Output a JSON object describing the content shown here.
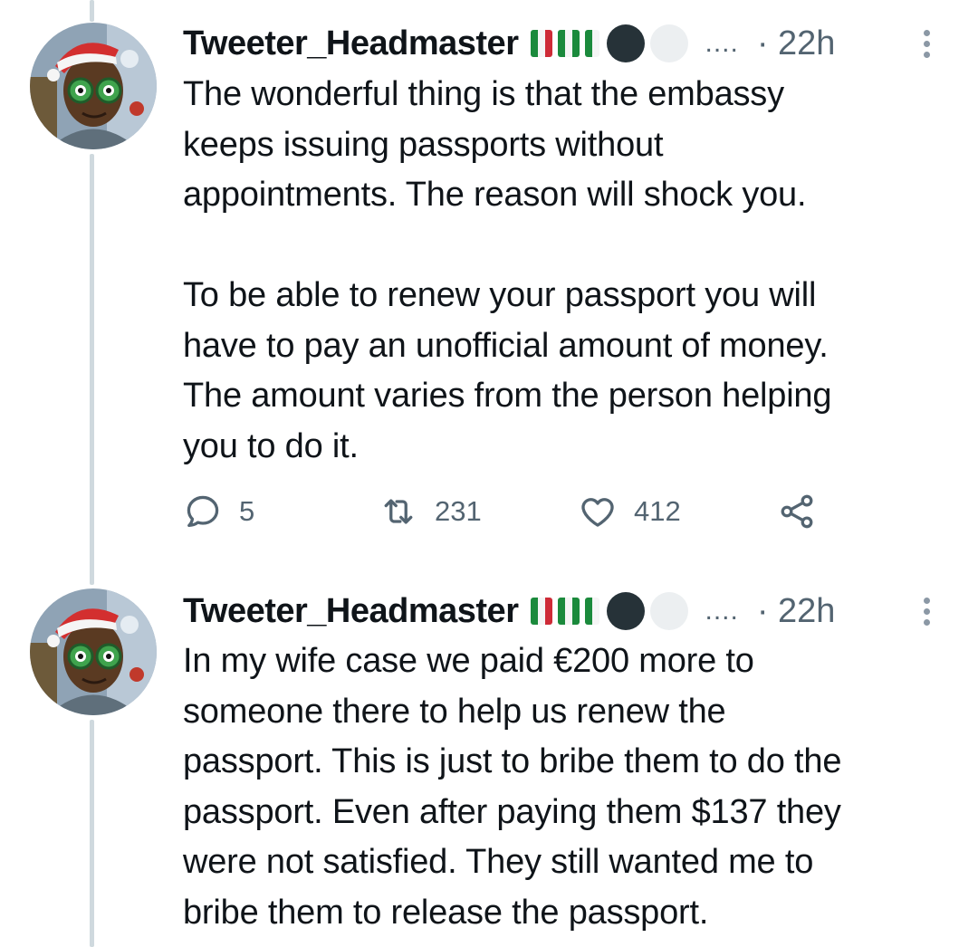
{
  "tweets": [
    {
      "username": "Tweeter_Headmaster",
      "more": "....",
      "time": "· 22h",
      "paragraphs": [
        "The wonderful thing is that the embassy\nkeeps issuing passports without\nappointments. The reason will shock you.",
        "To be able to renew your passport you will\nhave to pay an unofficial amount of money.\nThe amount varies from the person helping\nyou to do it."
      ],
      "actions": {
        "replies": "5",
        "retweets": "231",
        "likes": "412"
      }
    },
    {
      "username": "Tweeter_Headmaster",
      "more": "....",
      "time": "· 22h",
      "paragraphs": [
        "In my wife case we paid €200 more to\nsomeone there to help us renew the\npassport. This is just to bribe them to do the\npassport. Even after paying them $137 they\nwere not satisfied. They still wanted me to\nbribe them to release the passport."
      ]
    }
  ],
  "icons": {
    "reply": "reply-icon",
    "retweet": "retweet-icon",
    "like": "heart-icon",
    "share": "share-icon",
    "more": "more-vertical-icon",
    "flags": "italy-nigeria-flag-emoji"
  },
  "colors": {
    "text": "#0f1419",
    "secondary": "#536471",
    "thread_line": "#cfd9de",
    "flag_green": "#1b8a3c",
    "flag_red": "#ce2b37"
  }
}
